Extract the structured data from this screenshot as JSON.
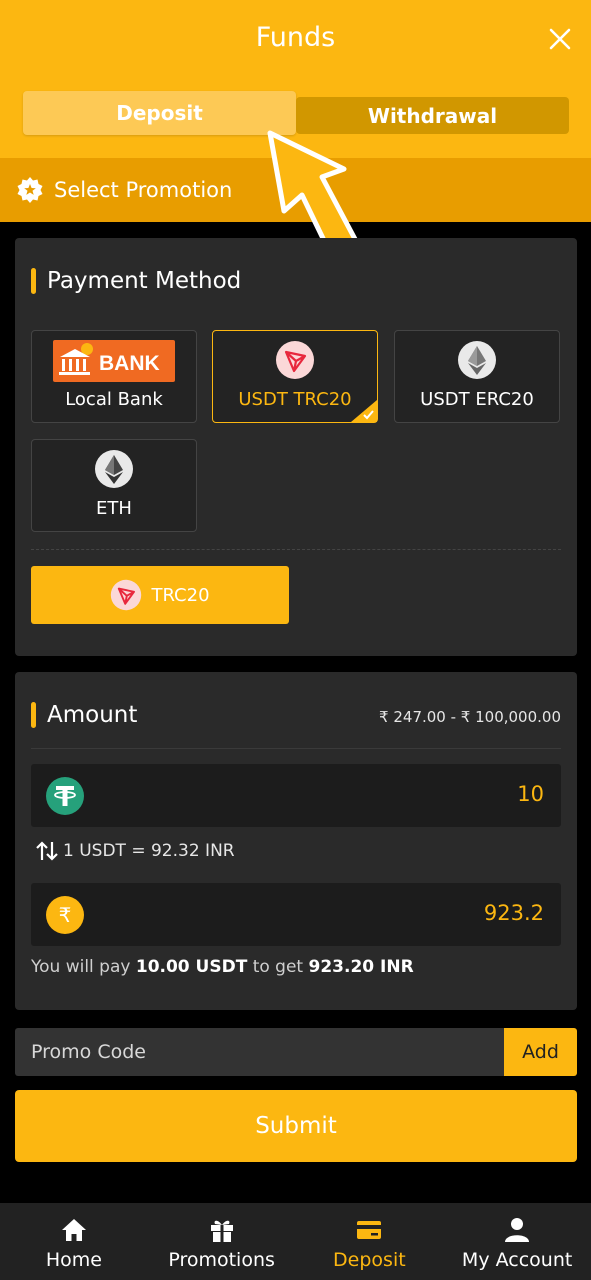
{
  "header": {
    "title": "Funds",
    "close_icon": "close-icon",
    "tabs": [
      {
        "label": "Deposit",
        "active": true
      },
      {
        "label": "Withdrawal",
        "active": false
      }
    ]
  },
  "promotion": {
    "label": "Select Promotion",
    "icon": "star-badge-icon"
  },
  "payment": {
    "title": "Payment Method",
    "methods": [
      {
        "label": "Local Bank",
        "icon": "bank-logo",
        "logo_text": "BANK",
        "selected": false
      },
      {
        "label": "USDT TRC20",
        "icon": "tron-icon",
        "selected": true
      },
      {
        "label": "USDT ERC20",
        "icon": "ethereum-icon",
        "selected": false
      },
      {
        "label": "ETH",
        "icon": "ethereum-icon",
        "selected": false
      }
    ],
    "network_button": "TRC20"
  },
  "amount": {
    "title": "Amount",
    "range": "₹ 247.00 - ₹ 100,000.00",
    "usdt_value": "10",
    "rate": "1 USDT = 92.32 INR",
    "inr_value": "923.2",
    "note_prefix": "You will pay ",
    "note_pay": "10.00 USDT",
    "note_mid": " to get ",
    "note_get": "923.20 INR"
  },
  "promo_code": {
    "placeholder": "Promo Code",
    "add_label": "Add"
  },
  "submit_label": "Submit",
  "nav": [
    {
      "label": "Home",
      "icon": "home-icon",
      "active": false
    },
    {
      "label": "Promotions",
      "icon": "gift-icon",
      "active": false
    },
    {
      "label": "Deposit",
      "icon": "card-icon",
      "active": true
    },
    {
      "label": "My Account",
      "icon": "user-icon",
      "active": false
    }
  ],
  "colors": {
    "accent": "#fcb711",
    "header_dark": "#e89d00",
    "card": "#2a2a2a",
    "usdt_green": "#26a17b",
    "tron_red": "#e8283d"
  }
}
